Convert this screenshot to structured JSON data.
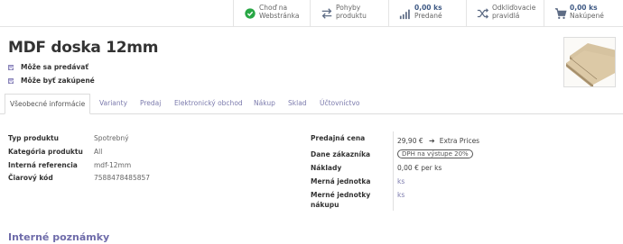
{
  "smart_buttons": [
    {
      "icon": "globe-check-icon",
      "line1": "Choď na",
      "line2": "Webstránka",
      "value": null
    },
    {
      "icon": "arrows-exchange-icon",
      "line1": "Pohyby",
      "line2": "produktu",
      "value": null
    },
    {
      "icon": "bar-chart-icon",
      "line1": "0,00 ks",
      "line2": "Predané",
      "value": true
    },
    {
      "icon": "shuffle-icon",
      "line1": "Odkliďovacie",
      "line2": "pravidlá",
      "value": null
    },
    {
      "icon": "shopping-cart-icon",
      "line1": "0,00 ks",
      "line2": "Nakúpené",
      "value": true
    }
  ],
  "product": {
    "title": "MDF doska 12mm",
    "can_be_sold": "Môže sa predávať",
    "can_be_purchased": "Môže byť zakúpené"
  },
  "tabs": [
    "Všeobecné informácie",
    "Varianty",
    "Predaj",
    "Elektronický obchod",
    "Nákup",
    "Sklad",
    "Účtovníctvo"
  ],
  "general": {
    "labels": [
      "Typ produktu",
      "Kategória produktu",
      "Interná referencia",
      "Čiarový kód"
    ],
    "values": [
      "Spotrebný",
      "All",
      "mdf-12mm",
      "7588478485857"
    ]
  },
  "pricing": {
    "sale_price_label": "Predajná cena",
    "sale_price": "29,90 €",
    "extra_prices": "Extra Prices",
    "customer_taxes_label": "Dane zákazníka",
    "customer_tax_badge": "DPH na výstupe 20%",
    "cost_label": "Náklady",
    "cost": "0,00 € per ks",
    "uom_label": "Merná jednotka",
    "uom": "ks",
    "purchase_uom_label_1": "Merné jednotky",
    "purchase_uom_label_2": "nákupu",
    "purchase_uom": "ks"
  },
  "notes": {
    "heading": "Interné poznámky"
  },
  "colors": {
    "link": "#7c7bad",
    "green": "#28a745",
    "accent": "#6f6caa",
    "badge_check": "#b7b2dc"
  }
}
